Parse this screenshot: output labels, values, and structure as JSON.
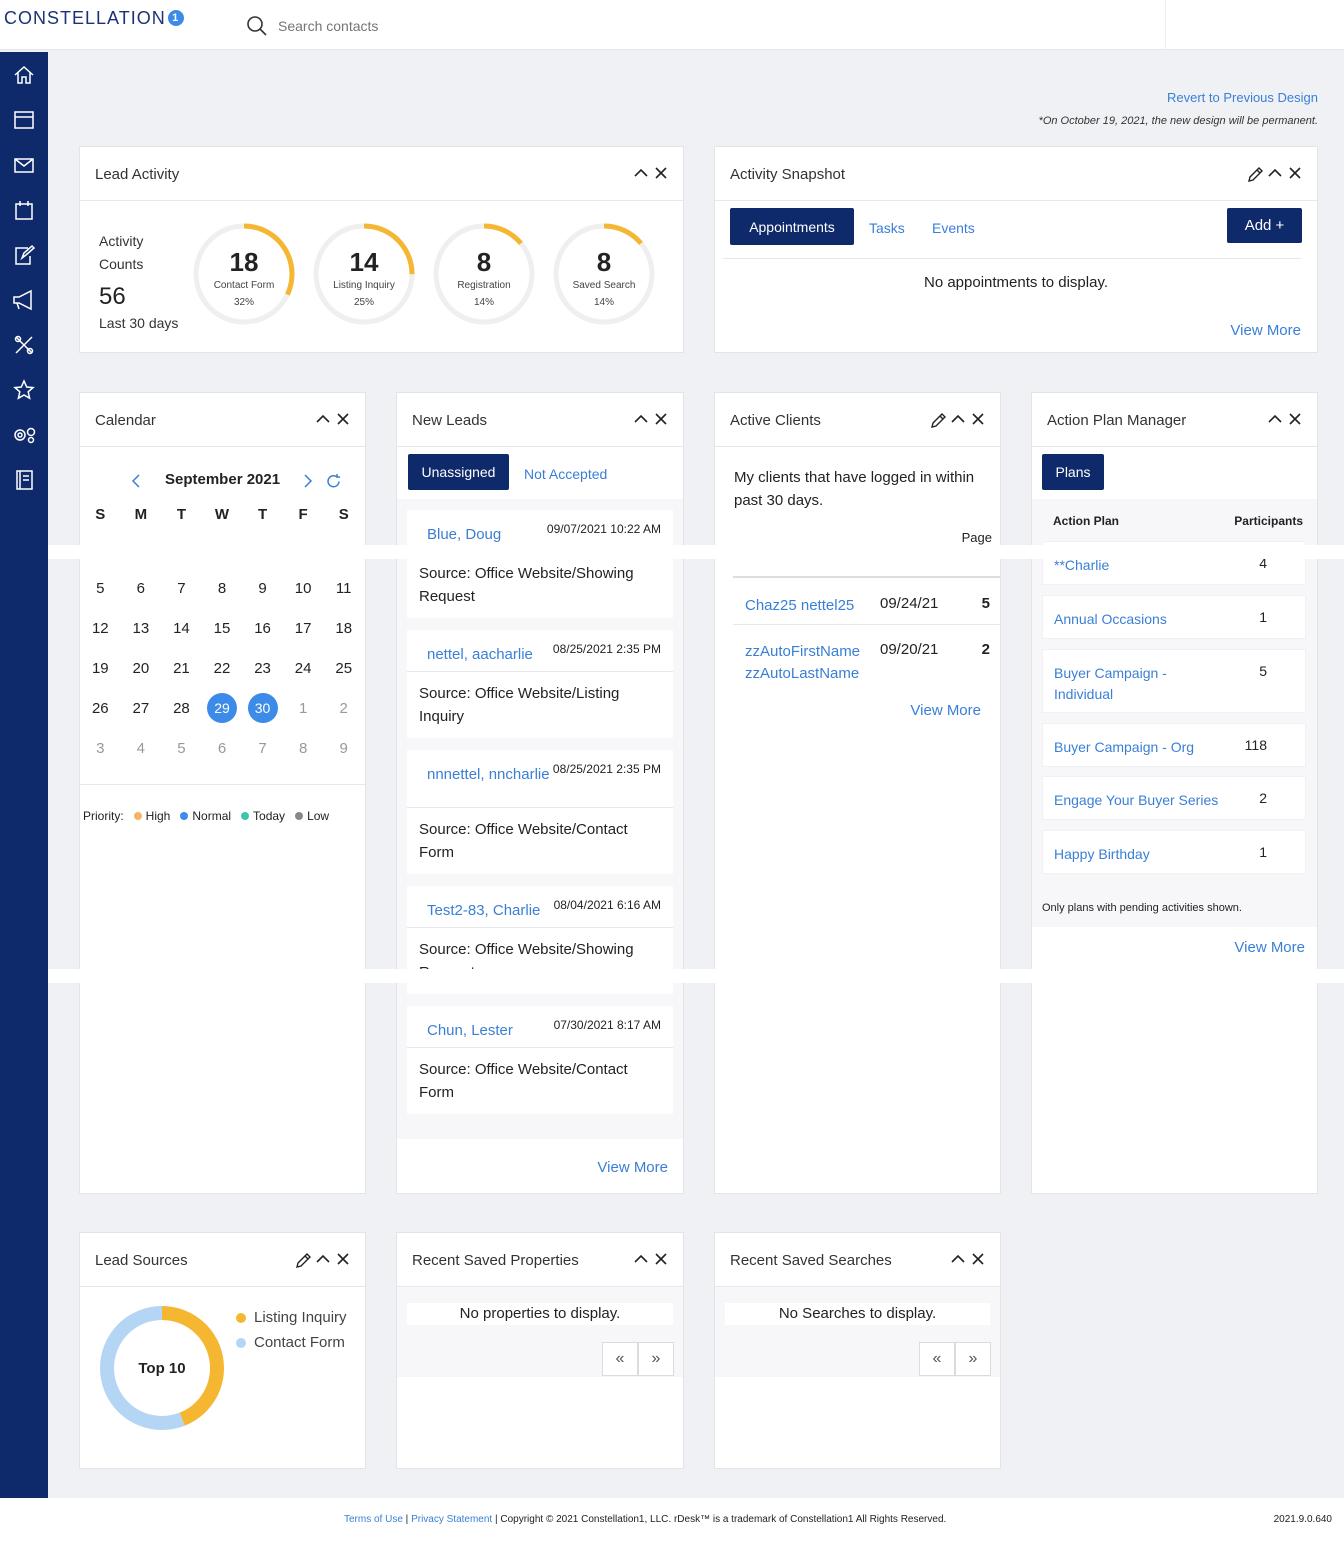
{
  "brand": {
    "name": "CONSTELLATION",
    "mark": "1"
  },
  "search": {
    "placeholder": "Search contacts"
  },
  "colors": {
    "sidebar": "#0f2a6b",
    "accent": "#3a7fd6",
    "gauge": "#f5b731",
    "selected_day": "#3d8be8"
  },
  "nav": [
    "home-icon",
    "window-icon",
    "mail-icon",
    "calendar-icon",
    "edit-document-icon",
    "megaphone-icon",
    "tools-icon",
    "star-icon",
    "gears-icon",
    "book-icon"
  ],
  "header": {
    "revert": "Revert to Previous Design",
    "notice": "*On October 19, 2021, the new design will be permanent."
  },
  "lead_activity": {
    "title": "Lead Activity",
    "counts_label1": "Activity",
    "counts_label2": "Counts",
    "total": "56",
    "period": "Last 30 days",
    "gauges": [
      {
        "value": "18",
        "label": "Contact Form",
        "pct": "32%",
        "fraction": 0.32
      },
      {
        "value": "14",
        "label": "Listing Inquiry",
        "pct": "25%",
        "fraction": 0.25
      },
      {
        "value": "8",
        "label": "Registration",
        "pct": "14%",
        "fraction": 0.14
      },
      {
        "value": "8",
        "label": "Saved Search",
        "pct": "14%",
        "fraction": 0.14
      }
    ]
  },
  "snapshot": {
    "title": "Activity Snapshot",
    "tabs": [
      "Appointments",
      "Tasks",
      "Events"
    ],
    "add": "Add +",
    "empty": "No appointments to display.",
    "view_more": "View More"
  },
  "calendar": {
    "title": "Calendar",
    "month": "September 2021",
    "dow": [
      "S",
      "M",
      "T",
      "W",
      "T",
      "F",
      "S"
    ],
    "weeks": [
      [
        "5",
        "6",
        "7",
        "8",
        "9",
        "10",
        "11"
      ],
      [
        "12",
        "13",
        "14",
        "15",
        "16",
        "17",
        "18"
      ],
      [
        "19",
        "20",
        "21",
        "22",
        "23",
        "24",
        "25"
      ],
      [
        "26",
        "27",
        "28",
        "29",
        "30",
        "1",
        "2"
      ],
      [
        "3",
        "4",
        "5",
        "6",
        "7",
        "8",
        "9"
      ]
    ],
    "priority_label": "Priority:",
    "priorities": [
      {
        "name": "High",
        "color": "#f5b460"
      },
      {
        "name": "Normal",
        "color": "#3d8be8"
      },
      {
        "name": "Today",
        "color": "#3cc5a8"
      },
      {
        "name": "Low",
        "color": "#888888"
      }
    ]
  },
  "new_leads": {
    "title": "New Leads",
    "tabs": [
      "Unassigned",
      "Not Accepted"
    ],
    "view_more": "View More",
    "items": [
      {
        "name": "Blue, Doug",
        "date": "09/07/2021 10:22 AM",
        "source": "Source: Office Website/Showing Request"
      },
      {
        "name": "nettel, aacharlie",
        "date": "08/25/2021 2:35 PM",
        "source": "Source: Office Website/Listing Inquiry"
      },
      {
        "name": "nnnettel, nncharlie",
        "date": "08/25/2021 2:35 PM",
        "source": "Source: Office Website/Contact Form"
      },
      {
        "name": "Test2-83, Charlie",
        "date": "08/04/2021 6:16 AM",
        "source": "Source: Office Website/Showing Request"
      },
      {
        "name": "Chun, Lester",
        "date": "07/30/2021 8:17 AM",
        "source": "Source: Office Website/Contact Form"
      }
    ]
  },
  "active_clients": {
    "title": "Active Clients",
    "desc": "My clients that have logged in within past 30 days.",
    "page": "Page",
    "view_more": "View More",
    "rows": [
      {
        "name": "Chaz25 nettel25",
        "date": "09/24/21",
        "hits": "5"
      },
      {
        "name": "zzAutoFirstName zzAutoLastName",
        "date": "09/20/21",
        "hits": "2"
      }
    ]
  },
  "action_plans": {
    "title": "Action Plan Manager",
    "tab": "Plans",
    "col1": "Action Plan",
    "col2": "Participants",
    "note": "Only plans with pending activities shown.",
    "view_more": "View More",
    "rows": [
      {
        "name": "**Charlie",
        "count": "4"
      },
      {
        "name": "Annual Occasions",
        "count": "1"
      },
      {
        "name": "Buyer Campaign - Individual",
        "count": "5"
      },
      {
        "name": "Buyer Campaign - Org",
        "count": "118"
      },
      {
        "name": "Engage Your Buyer Series",
        "count": "2"
      },
      {
        "name": "Happy Birthday",
        "count": "1"
      }
    ]
  },
  "lead_sources": {
    "title": "Lead Sources",
    "center": "Top 10",
    "legend": [
      {
        "name": "Listing Inquiry",
        "color": "#f5b731",
        "fraction": 0.44
      },
      {
        "name": "Contact Form",
        "color": "#b5d5f5",
        "fraction": 0.56
      }
    ]
  },
  "saved_props": {
    "title": "Recent Saved Properties",
    "empty": "No properties to display."
  },
  "saved_searches": {
    "title": "Recent Saved Searches",
    "empty": "No Searches to display."
  },
  "footer": {
    "terms": "Terms of Use",
    "privacy": "Privacy Statement",
    "copyright": "| Copyright © 2021 Constellation1, LLC. rDesk™ is a trademark of Constellation1 All Rights Reserved.",
    "version": "2021.9.0.640"
  }
}
